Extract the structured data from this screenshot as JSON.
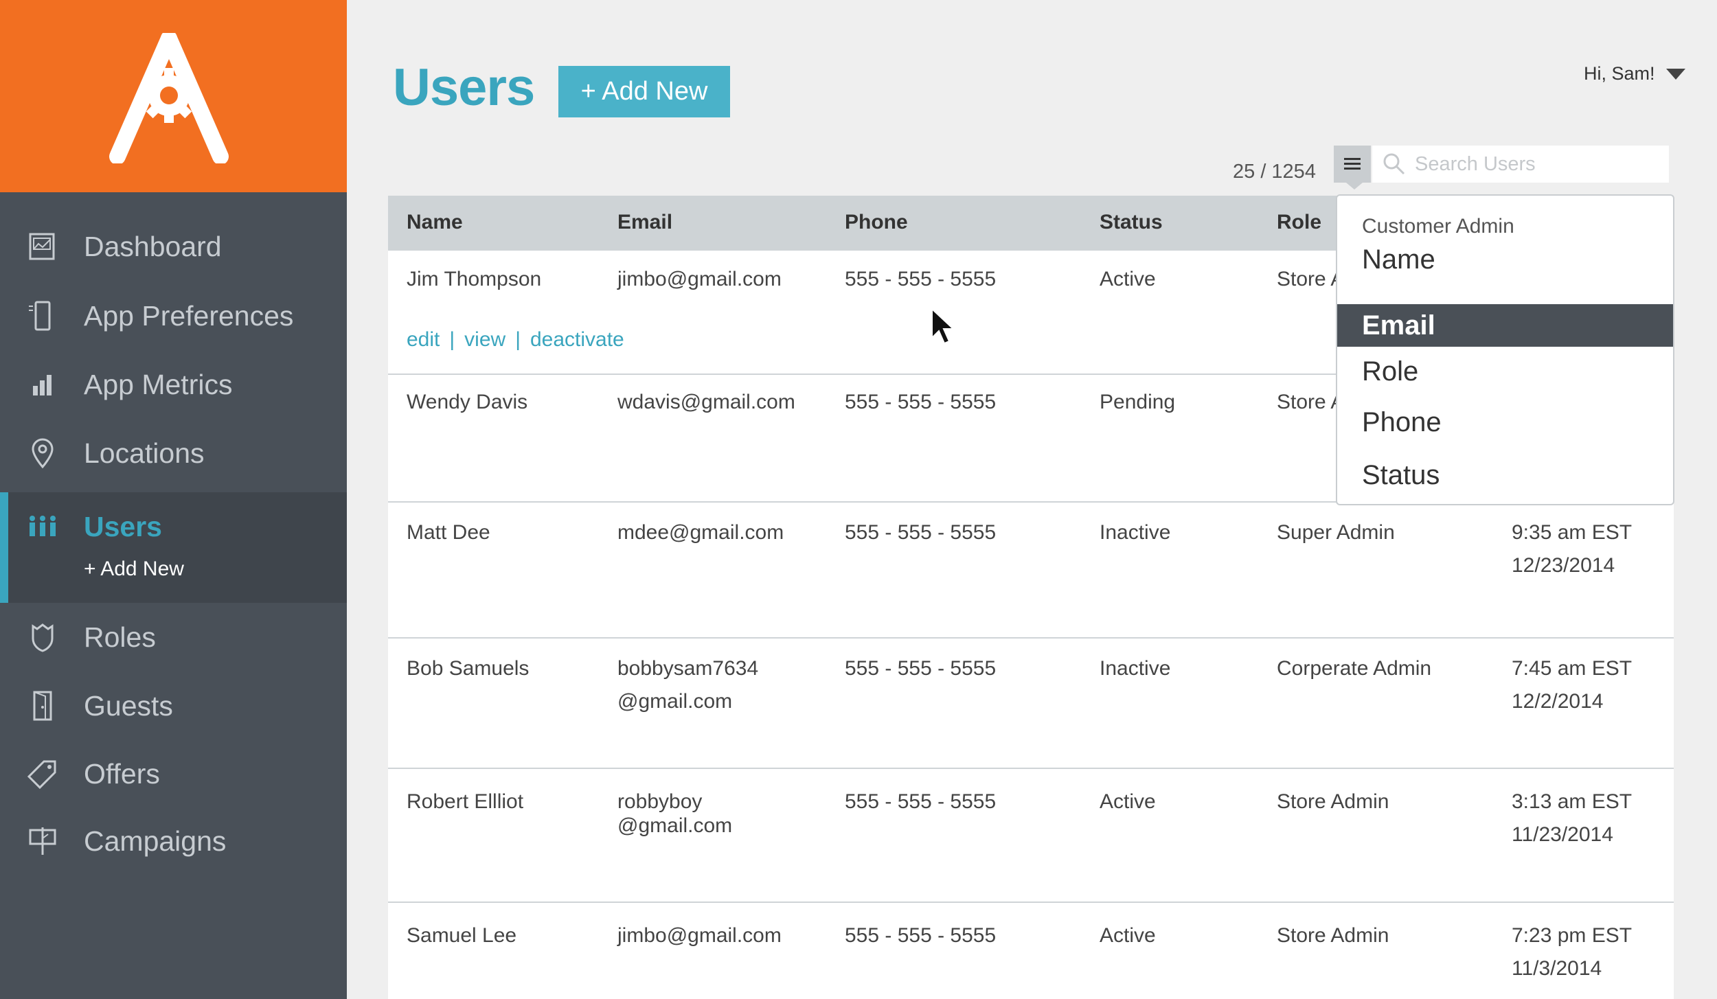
{
  "sidebar": {
    "items": [
      {
        "label": "Dashboard",
        "icon": "dashboard-icon"
      },
      {
        "label": "App Preferences",
        "icon": "phone-icon"
      },
      {
        "label": "App Metrics",
        "icon": "bar-chart-icon"
      },
      {
        "label": "Locations",
        "icon": "map-pin-icon"
      },
      {
        "label": "Users",
        "icon": "users-icon"
      },
      {
        "label": "Roles",
        "icon": "shield-icon"
      },
      {
        "label": "Guests",
        "icon": "door-icon"
      },
      {
        "label": "Offers",
        "icon": "tag-icon"
      },
      {
        "label": "Campaigns",
        "icon": "signpost-icon"
      }
    ],
    "sub_item": "+ Add New",
    "active": "Users"
  },
  "header": {
    "title": "Users",
    "add_button": "+ Add New",
    "greeting": "Hi, Sam!"
  },
  "toolbar": {
    "count": "25 / 1254",
    "search_placeholder": "Search Users"
  },
  "table": {
    "columns": [
      "Name",
      "Email",
      "Phone",
      "Status",
      "Role"
    ],
    "rows": [
      {
        "name": "Jim Thompson",
        "email": "jimbo@gmail.com",
        "phone": "555 - 555 - 5555",
        "status": "Active",
        "role": "Store A",
        "time": "",
        "date": ""
      },
      {
        "name": "Wendy Davis",
        "email": "wdavis@gmail.com",
        "phone": "555 - 555 - 5555",
        "status": "Pending",
        "role": "Store A",
        "time": "",
        "date": ""
      },
      {
        "name": "Matt Dee",
        "email": "mdee@gmail.com",
        "phone": "555 - 555 - 5555",
        "status": "Inactive",
        "role": "Super Admin",
        "time": "9:35 am EST",
        "date": "12/23/2014"
      },
      {
        "name": "Bob Samuels",
        "email": "bobbysam7634",
        "email2": "@gmail.com",
        "phone": "555 - 555 - 5555",
        "status": "Inactive",
        "role": "Corperate Admin",
        "time": "7:45 am EST",
        "date": "12/2/2014"
      },
      {
        "name": "Robert Ellliot",
        "email": "robbyboy",
        "email2": "@gmail.com",
        "phone": "555 - 555 - 5555",
        "status": "Active",
        "role": "Store Admin",
        "time": "3:13 am EST",
        "date": "11/23/2014"
      },
      {
        "name": "Samuel Lee",
        "email": "jimbo@gmail.com",
        "phone": "555 - 555 - 5555",
        "status": "Active",
        "role": "Store Admin",
        "time": "7:23 pm EST",
        "date": "11/3/2014"
      }
    ],
    "row_actions": [
      "edit",
      "view",
      "deactivate"
    ],
    "action_separator": "|"
  },
  "dropdown": {
    "header": "Customer Admin",
    "options": [
      "Name",
      "Email",
      "Role",
      "Phone",
      "Status"
    ],
    "selected": "Email"
  },
  "colors": {
    "brand_orange": "#f26f21",
    "accent_teal": "#3aa5be",
    "sidebar_bg": "#495058"
  }
}
